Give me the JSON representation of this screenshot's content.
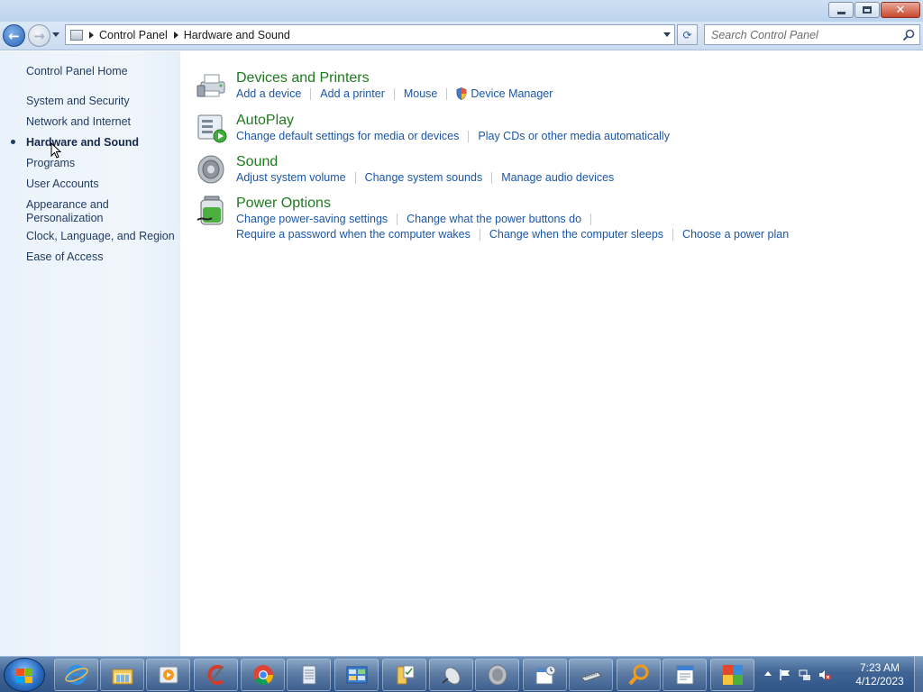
{
  "window": {
    "caption": {
      "minimize": "minimize",
      "maximize": "restore",
      "close": "close"
    }
  },
  "address_bar": {
    "crumbs": [
      "Control Panel",
      "Hardware and Sound"
    ],
    "search_placeholder": "Search Control Panel"
  },
  "left_nav": {
    "home": "Control Panel Home",
    "items": [
      "System and Security",
      "Network and Internet",
      "Hardware and Sound",
      "Programs",
      "User Accounts",
      "Appearance and Personalization",
      "Clock, Language, and Region",
      "Ease of Access"
    ],
    "current": "Hardware and Sound"
  },
  "categories": [
    {
      "title": "Devices and Printers",
      "icon": "printer-icon",
      "links": [
        "Add a device",
        "Add a printer",
        "Mouse",
        "Device Manager"
      ]
    },
    {
      "title": "AutoPlay",
      "icon": "autoplay-icon",
      "links": [
        "Change default settings for media or devices",
        "Play CDs or other media automatically"
      ]
    },
    {
      "title": "Sound",
      "icon": "speaker-icon",
      "links": [
        "Adjust system volume",
        "Change system sounds",
        "Manage audio devices"
      ]
    },
    {
      "title": "Power Options",
      "icon": "battery-icon",
      "links": [
        "Change power-saving settings",
        "Change what the power buttons do",
        "Require a password when the computer wakes",
        "Change when the computer sleeps",
        "Choose a power plan"
      ]
    }
  ],
  "taskbar": {
    "pinned": [
      "internet-explorer-icon",
      "windows-explorer-icon",
      "media-player-icon",
      "ccleaner-icon",
      "chrome-icon",
      "notepad-icon",
      "control-panel-icon",
      "folder-tasks-icon",
      "mouse-icon",
      "speaker-icon",
      "calendar-icon",
      "keyboard-icon",
      "search-magnifier-icon",
      "document-icon",
      "avg-icon"
    ],
    "clock_time": "7:23 AM",
    "clock_date": "4/12/2023"
  }
}
